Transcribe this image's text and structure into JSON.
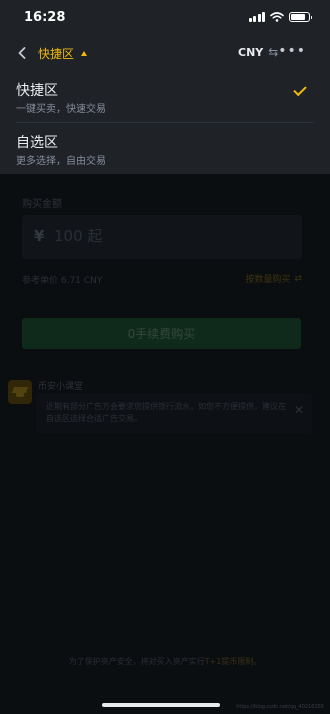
{
  "status_bar": {
    "time": "16:28",
    "icons": [
      "signal-icon",
      "wifi-icon",
      "battery-icon"
    ]
  },
  "nav": {
    "back_icon": "chevron-left-icon",
    "title": "快捷区",
    "title_icon": "caret-up-icon",
    "currency": "CNY",
    "swap_icon": "swap-arrows-icon",
    "more_icon": "more-dots-icon"
  },
  "dropdown": {
    "items": [
      {
        "title": "快捷区",
        "description": "一键买卖，快速交易",
        "selected": true
      },
      {
        "title": "自选区",
        "description": "更多选择，自由交易",
        "selected": false
      }
    ]
  },
  "buy_form": {
    "amount_label": "购买金额",
    "currency_symbol": "¥",
    "amount_placeholder": "100 起",
    "reference_price": "参考单价 6.71 CNY",
    "buy_by_quantity": "按数量购买",
    "buy_button": "0手续费购买"
  },
  "class_section": {
    "title": "币安小课堂",
    "notice": "近期有部分广告方会要求您提供银行流水，如您不方便提供，建议在自选区选择合适广告交易。"
  },
  "footer": {
    "note_prefix": "为了保护资产安全，将对买入资产实行",
    "note_highlight": "T+1提币限制",
    "note_suffix": "。",
    "watermark": "https://blog.csdn.net/qq_40216265"
  },
  "colors": {
    "accent": "#f0b90b",
    "panel": "#1f2328",
    "background": "#0b0e11",
    "buy_button_dim": "#0f2a1a"
  }
}
